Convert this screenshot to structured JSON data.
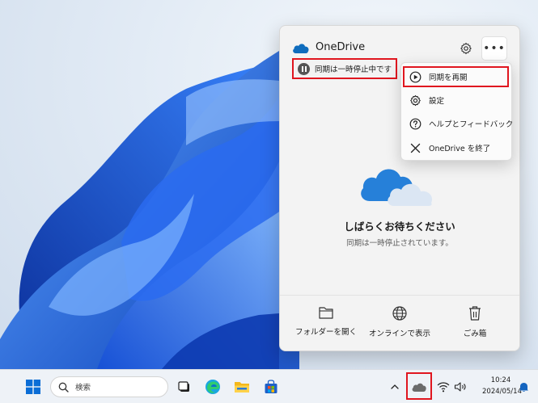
{
  "panel": {
    "title": "OneDrive",
    "status": "同期は一時停止中です",
    "more_label": "•••",
    "wait_title": "しばらくお待ちください",
    "wait_subtitle": "同期は一時停止されています。",
    "footer": [
      {
        "label": "フォルダーを開く",
        "icon": "folder-icon"
      },
      {
        "label": "オンラインで表示",
        "icon": "globe-icon"
      },
      {
        "label": "ごみ箱",
        "icon": "trash-icon"
      }
    ]
  },
  "menu": {
    "items": [
      {
        "label": "同期を再開",
        "icon": "play-circle-icon",
        "highlighted": true
      },
      {
        "label": "設定",
        "icon": "gear-icon"
      },
      {
        "label": "ヘルプとフィードバック",
        "icon": "question-circle-icon"
      },
      {
        "label": "OneDrive を終了",
        "icon": "close-icon"
      }
    ]
  },
  "taskbar": {
    "search_placeholder": "検索",
    "clock_time": "10:24",
    "clock_date": "2024/05/14"
  },
  "colors": {
    "highlight_border": "#e0161f",
    "onedrive_blue": "#0f6cbd",
    "wallpaper_blue": "#1e5fd9"
  }
}
